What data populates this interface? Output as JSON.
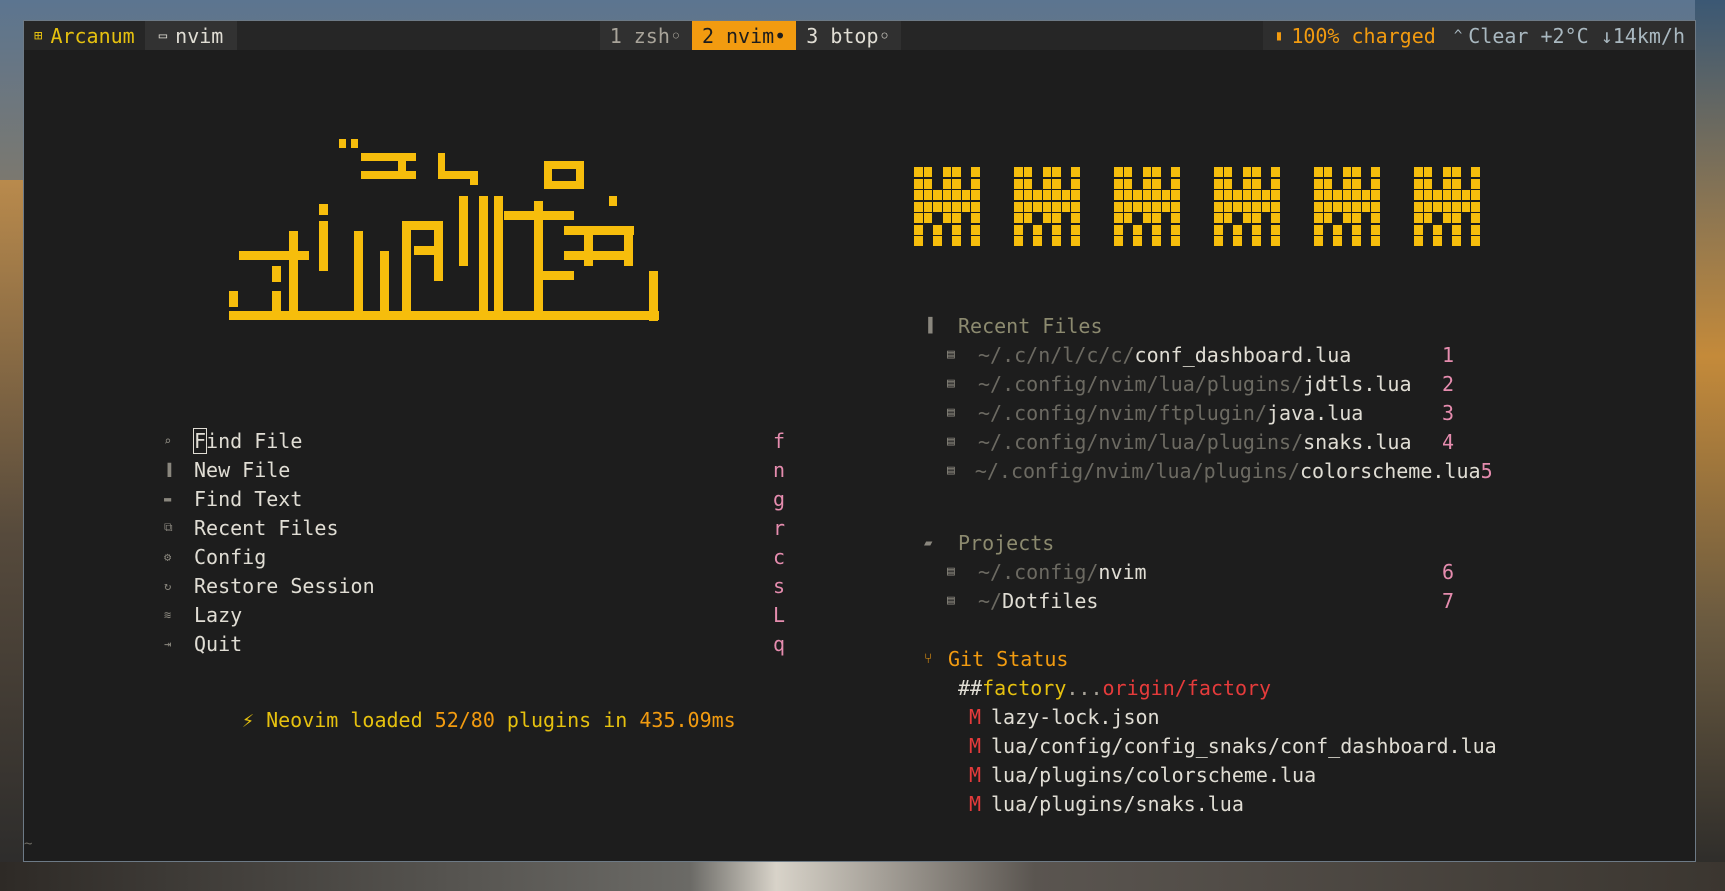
{
  "tmux": {
    "session": "Arcanum",
    "app": "nvim",
    "windows": [
      {
        "label": "1 zsh◦"
      },
      {
        "label": "2 nvim•"
      },
      {
        "label": "3 btop◦"
      }
    ],
    "battery": "100% charged",
    "weather": "Clear +2°C ↓14km/h"
  },
  "dashboard": {
    "menu": [
      {
        "label": "Find File",
        "key": "f",
        "icon": "search-icon"
      },
      {
        "label": "New File",
        "key": "n",
        "icon": "file-icon"
      },
      {
        "label": "Find Text",
        "key": "g",
        "icon": "text-icon"
      },
      {
        "label": "Recent Files",
        "key": "r",
        "icon": "copy-icon"
      },
      {
        "label": "Config",
        "key": "c",
        "icon": "gear-icon"
      },
      {
        "label": "Restore Session",
        "key": "s",
        "icon": "restore-icon"
      },
      {
        "label": "Lazy",
        "key": "L",
        "icon": "lazy-icon"
      },
      {
        "label": "Quit",
        "key": "q",
        "icon": "exit-icon"
      }
    ],
    "startup": {
      "prefix": "⚡ Neovim loaded ",
      "loaded": "52/80",
      "middle": " plugins in ",
      "time": "435.09ms"
    },
    "recent_files": {
      "title": "Recent Files",
      "items": [
        {
          "dir": "~/.c/n/l/c/c/",
          "name": "conf_dashboard.lua",
          "key": "1"
        },
        {
          "dir": "~/.config/nvim/lua/plugins/",
          "name": "jdtls.lua",
          "key": "2"
        },
        {
          "dir": "~/.config/nvim/ftplugin/",
          "name": "java.lua",
          "key": "3"
        },
        {
          "dir": "~/.config/nvim/lua/plugins/",
          "name": "snaks.lua",
          "key": "4"
        },
        {
          "dir": "~/.config/nvim/lua/plugins/",
          "name": "colorscheme.lua",
          "key": "5"
        }
      ]
    },
    "projects": {
      "title": "Projects",
      "items": [
        {
          "dir": "~/.config/",
          "name": "nvim",
          "key": "6"
        },
        {
          "dir": "~/",
          "name": "Dotfiles",
          "key": "7"
        }
      ]
    },
    "git": {
      "title": "Git Status",
      "branch_prefix": "## ",
      "branch": "factory",
      "dots": "...",
      "remote": "origin/factory",
      "changes": [
        {
          "mark": "M",
          "path": "lazy-lock.json"
        },
        {
          "mark": "M",
          "path": "lua/config/config_snaks/conf_dashboard.lua"
        },
        {
          "mark": "M",
          "path": "lua/plugins/colorscheme.lua"
        },
        {
          "mark": "M",
          "path": "lua/plugins/snaks.lua"
        }
      ]
    },
    "tilde": "~"
  },
  "colors": {
    "accent": "#f29b10",
    "logo": "#f6bd0c",
    "key": "#e58cae",
    "git_mod": "#e53b3b"
  }
}
